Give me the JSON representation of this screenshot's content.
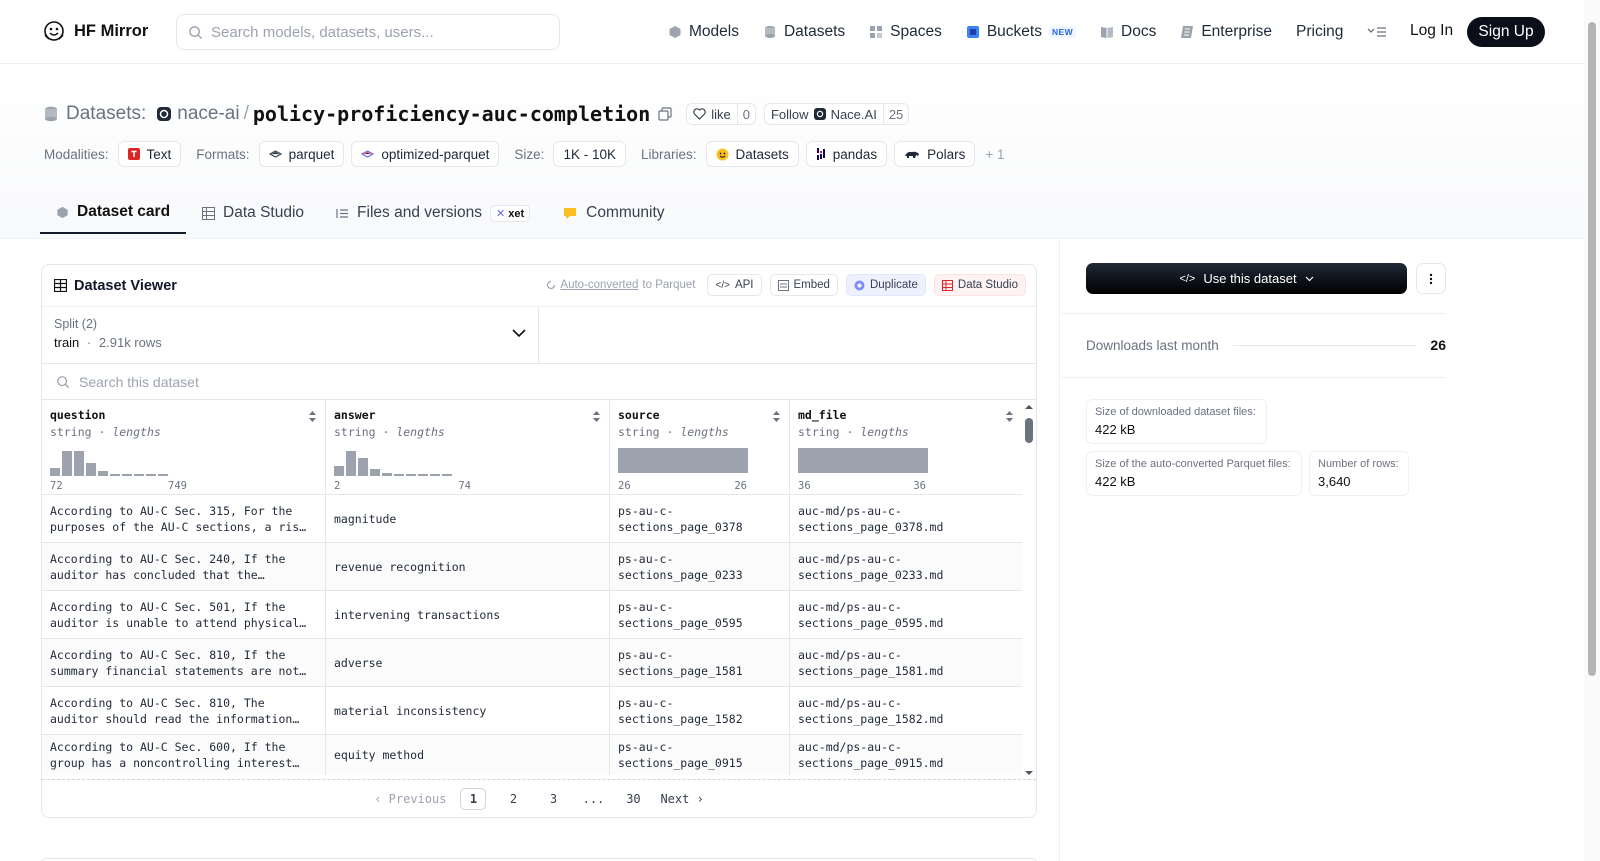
{
  "nav": {
    "brand": "HF Mirror",
    "search_placeholder": "Search models, datasets, users...",
    "links": [
      {
        "label": "Models",
        "icon": "models-icon"
      },
      {
        "label": "Datasets",
        "icon": "datasets-icon"
      },
      {
        "label": "Spaces",
        "icon": "spaces-icon"
      },
      {
        "label": "Buckets",
        "icon": "buckets-icon",
        "badge": "NEW"
      },
      {
        "label": "Docs",
        "icon": "docs-icon"
      },
      {
        "label": "Enterprise",
        "icon": "enterprise-icon"
      },
      {
        "label": "Pricing"
      }
    ],
    "login": "Log In",
    "signup": "Sign Up"
  },
  "header": {
    "category": "Datasets:",
    "org": "nace-ai",
    "slash": "/",
    "name": "policy-proficiency-auc-completion",
    "like_label": "like",
    "like_count": "0",
    "follow_label": "Follow",
    "follow_org": "Nace.AI",
    "follow_count": "25"
  },
  "meta": {
    "modalities_label": "Modalities:",
    "modalities": [
      "Text"
    ],
    "formats_label": "Formats:",
    "formats": [
      "parquet",
      "optimized-parquet"
    ],
    "size_label": "Size:",
    "size": "1K - 10K",
    "libraries_label": "Libraries:",
    "libraries": [
      "Datasets",
      "pandas",
      "Polars"
    ],
    "libraries_more": "+ 1"
  },
  "tabs": [
    {
      "label": "Dataset card",
      "active": true
    },
    {
      "label": "Data Studio"
    },
    {
      "label": "Files and versions",
      "badge": "xet"
    },
    {
      "label": "Community"
    }
  ],
  "viewer": {
    "title": "Dataset Viewer",
    "auto_converted": "Auto-converted",
    "auto_suffix": " to Parquet",
    "api": "API",
    "embed": "Embed",
    "duplicate": "Duplicate",
    "data_studio": "Data Studio",
    "split_label": "Split (2)",
    "split_name": "train",
    "split_dot": "·",
    "split_rows": "2.91k rows",
    "search_placeholder": "Search this dataset",
    "columns": [
      {
        "name": "question",
        "type": "string",
        "sep": " · ",
        "stat": "lengths",
        "min": "72",
        "max": "749",
        "hist": [
          0.3,
          0.95,
          0.95,
          0.5,
          0.2,
          0.08,
          0.05,
          0.05,
          0.05,
          0.05
        ]
      },
      {
        "name": "answer",
        "type": "string",
        "sep": " · ",
        "stat": "lengths",
        "min": "2",
        "max": "74",
        "hist": [
          0.4,
          0.95,
          0.7,
          0.25,
          0.1,
          0.05,
          0.05,
          0.05,
          0.05,
          0.05
        ]
      },
      {
        "name": "source",
        "type": "string",
        "sep": " · ",
        "stat": "lengths",
        "min": "26",
        "max": "26",
        "hist": [
          1
        ]
      },
      {
        "name": "md_file",
        "type": "string",
        "sep": " · ",
        "stat": "lengths",
        "min": "36",
        "max": "36",
        "hist": [
          1
        ]
      }
    ],
    "rows": [
      [
        "According to AU-C Sec. 315, For the purposes of the AU-C sections, a ris…",
        "magnitude",
        "ps-au-c-sections_page_0378",
        "auc-md/ps-au-c-sections_page_0378.md"
      ],
      [
        "According to AU-C Sec. 240, If the auditor has concluded that the…",
        "revenue recognition",
        "ps-au-c-sections_page_0233",
        "auc-md/ps-au-c-sections_page_0233.md"
      ],
      [
        "According to AU-C Sec. 501, If the auditor is unable to attend physical…",
        "intervening transactions",
        "ps-au-c-sections_page_0595",
        "auc-md/ps-au-c-sections_page_0595.md"
      ],
      [
        "According to AU-C Sec. 810, If the summary financial statements are not…",
        "adverse",
        "ps-au-c-sections_page_1581",
        "auc-md/ps-au-c-sections_page_1581.md"
      ],
      [
        "According to AU-C Sec. 810, The auditor should read the information…",
        "material inconsistency",
        "ps-au-c-sections_page_1582",
        "auc-md/ps-au-c-sections_page_1582.md"
      ],
      [
        "According to AU-C Sec. 600, If the group has a noncontrolling interest…",
        "equity method",
        "ps-au-c-sections_page_0915",
        "auc-md/ps-au-c-sections_page_0915.md"
      ]
    ],
    "pager": {
      "previous": "Previous",
      "pages": [
        "1",
        "2",
        "3",
        "...",
        "30"
      ],
      "current": "1",
      "next": "Next"
    }
  },
  "sidebar": {
    "use_dataset": "Use this dataset",
    "downloads_label": "Downloads last month",
    "downloads": "26",
    "stats": [
      {
        "label": "Size of downloaded dataset files:",
        "value": "422 kB"
      },
      {
        "label": "Size of the auto-converted Parquet files:",
        "value": "422 kB"
      },
      {
        "label": "Number of rows:",
        "value": "3,640"
      }
    ]
  }
}
